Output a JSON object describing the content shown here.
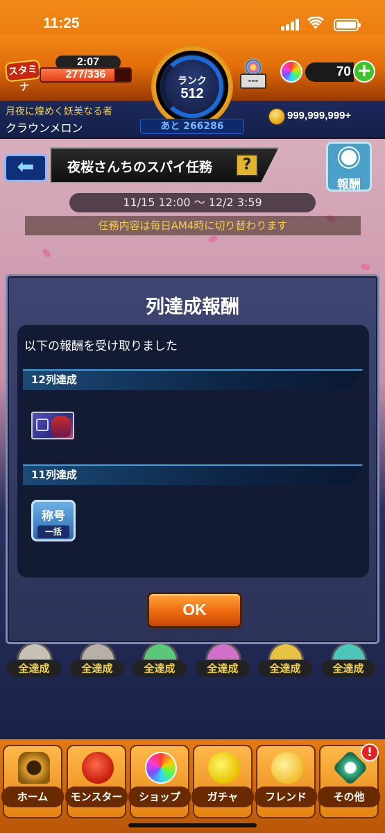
{
  "status_bar": {
    "time": "11:25"
  },
  "header": {
    "stamina_label": "スタミナ",
    "stamina_timer": "2:07",
    "stamina_value": "277/336",
    "stamina_ratio": 0.824,
    "rank_label": "ランク",
    "rank_value": "512",
    "rank_next": "あと 266286",
    "pack_label": "---",
    "gem_count": "70",
    "gem_add": "+",
    "player_title": "月夜に煌めく妖美なる者",
    "player_name": "クラウンメロン",
    "coin_count": "999,999,999+"
  },
  "event": {
    "title": "夜桜さんちのスパイ任務",
    "help": "?",
    "reward_button": "報酬",
    "period": "11/15 12:00 〜 12/2 3:59",
    "notice": "任務内容は毎日AM4時に切り替わります"
  },
  "medals": [
    "全達成",
    "全達成",
    "全達成",
    "全達成",
    "全達成",
    "全達成"
  ],
  "dialog": {
    "title": "列達成報酬",
    "message": "以下の報酬を受け取りました",
    "sections": [
      {
        "label": "12列達成"
      },
      {
        "label": "11列達成"
      }
    ],
    "title_badge_top": "称号",
    "title_badge_bottom": "一括",
    "ok_label": "OK"
  },
  "bottom_nav": {
    "items": [
      {
        "label": "ホーム",
        "icon": "home-gate-icon"
      },
      {
        "label": "モンスター",
        "icon": "monster-icon"
      },
      {
        "label": "ショップ",
        "icon": "orb-shop-icon"
      },
      {
        "label": "ガチャ",
        "icon": "gacha-egg-icon"
      },
      {
        "label": "フレンド",
        "icon": "friend-icon"
      },
      {
        "label": "その他",
        "icon": "other-icon"
      }
    ],
    "badge": "!"
  },
  "colors": {
    "accent_orange": "#ee6a10",
    "dialog_bg": "#2c3258",
    "panel_bg": "#121b33",
    "section_line": "#39a3e0"
  }
}
